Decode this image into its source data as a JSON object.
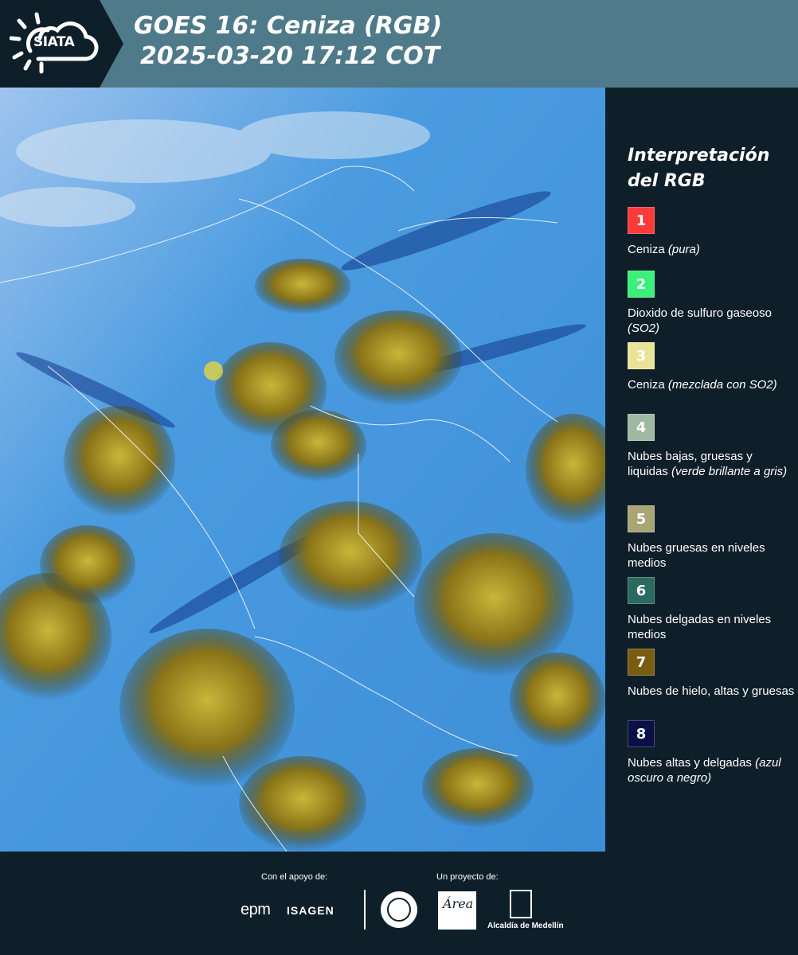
{
  "header": {
    "logo_text": "SIATA",
    "title_line1": "GOES 16: Ceniza (RGB)",
    "title_line2": "2025-03-20 17:12 COT"
  },
  "legend": {
    "title": "Interpretación del RGB",
    "items": [
      {
        "number": "1",
        "color": "#ff3a3a",
        "label": "Ceniza",
        "note": "(pura)"
      },
      {
        "number": "2",
        "color": "#3af07a",
        "label": "Dioxido de sulfuro gaseoso",
        "note": "(SO2)"
      },
      {
        "number": "3",
        "color": "#e9e398",
        "label": "Ceniza",
        "note": "(mezclada con SO2)"
      },
      {
        "number": "4",
        "color": "#9fb8a2",
        "label": "Nubes bajas, gruesas y liquidas",
        "note": "(verde brillante a gris)"
      },
      {
        "number": "5",
        "color": "#a9a574",
        "label": "Nubes gruesas en niveles medios",
        "note": ""
      },
      {
        "number": "6",
        "color": "#2a6a60",
        "label": "Nubes delgadas en niveles medios",
        "note": ""
      },
      {
        "number": "7",
        "color": "#7a5c10",
        "label": "Nubes de hielo, altas y gruesas",
        "note": ""
      },
      {
        "number": "8",
        "color": "#0a0f45",
        "label": "Nubes altas y delgadas",
        "note": "(azul oscuro a negro)"
      }
    ]
  },
  "footer": {
    "support_label": "Con el apoyo de:",
    "project_label": "Un proyecto de:",
    "epm": "epm",
    "isagen": "ISAGEN",
    "area_text": "Área",
    "alcaldia": "Alcaldía de Medellín"
  }
}
